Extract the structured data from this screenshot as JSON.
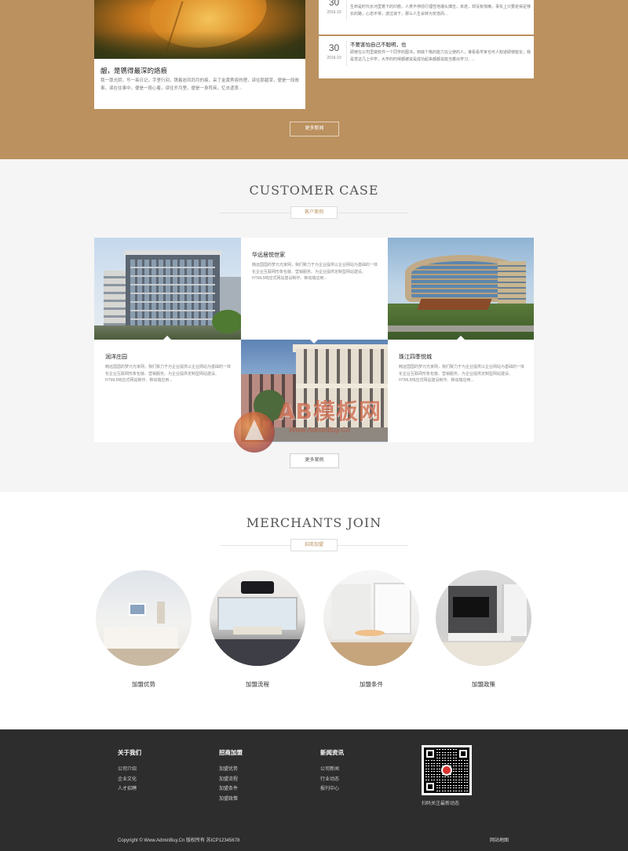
{
  "news": {
    "featured": {
      "title": "龈，是镌得最深的烙痕",
      "desc": "我一尊光阴，写一串日记，字里行间，镌着逝风同月的痕，采了金黄秀容的理，读往那碧草，便是一段故事，读在往事中，便是一段心着，读往岁月里，便是一身阵疾，忆去遗衷..."
    },
    "items": [
      {
        "day": "30",
        "ym": "2016-10",
        "title": "",
        "desc": "生命是时代长河里镌下的印痕，人类不停前行理性地潮头搏击，未遂，却没有惰懒，事实上只要走得足够长的路，心态平常，波过浪下，那么人生会转为安逸而..."
      },
      {
        "day": "30",
        "ym": "2016-10",
        "title": "不要害怕自己不聪明，也",
        "desc": "即使在公司里做软件一个同学的图书，到底个像的能力在让使的人，谁看看学家也可人知道即使能论，我是觉这几上中学，大学的时候都被说是成功起来都都说能当着出学习、..."
      }
    ],
    "more_label": "更多新闻"
  },
  "cases": {
    "title": "CUSTOMER CASE",
    "subtitle": "客户案例",
    "items": [
      {
        "name": "华远居悦世家",
        "desc": "韩远国国的梦元光家网，我们致力于为企业提供以企业网站为基础的一体化企业互联网形象包装、营销服务。为企业提供定制型网站建设、HTML5响应式网站建设制作、移动端应用..."
      },
      {
        "name": "润洋庄园",
        "desc": "韩远国国的梦元光家网，我们致力于为企业提供以企业网站为基础的一体化企业互联网形象包装、营销服务。为企业提供定制型网站建设、HTML5响应式网站制作、移动端应用..."
      },
      {
        "name": "珠江四季悦城",
        "desc": "韩远国国的梦元光家网，我们致力于为企业提供以企业网站为基础的一体化企业互联网形象包装、营销服务。为企业提供定制型网站建设、HTML5响应式网站建设制作、移动端应用..."
      }
    ],
    "more_label": "更多案例"
  },
  "merchants": {
    "title": "MERCHANTS JOIN",
    "subtitle": "招商加盟",
    "items": [
      "加盟优势",
      "加盟流程",
      "加盟条件",
      "加盟政策"
    ]
  },
  "footer": {
    "columns": [
      {
        "heading": "关于我们",
        "links": [
          "公司介绍",
          "企业文化",
          "人才招聘"
        ]
      },
      {
        "heading": "招商加盟",
        "links": [
          "加盟优势",
          "加盟流程",
          "加盟条件",
          "加盟政策"
        ]
      },
      {
        "heading": "新闻资讯",
        "links": [
          "公司新闻",
          "行业动态",
          "报刊中心"
        ]
      }
    ],
    "qr_caption": "扫码关注最新动态",
    "copyright": "Copyright © Www.AdminBuy.Cn 版权所有  苏ICP12345678",
    "sitemap": "网站地图"
  },
  "watermark": {
    "text": "AB模板网",
    "url": "Www.AdminBuy.Cn"
  },
  "colors": {
    "accent": "#bb915f",
    "footer_bg": "#2d2d2d",
    "section_bg": "#f5f5f5"
  }
}
